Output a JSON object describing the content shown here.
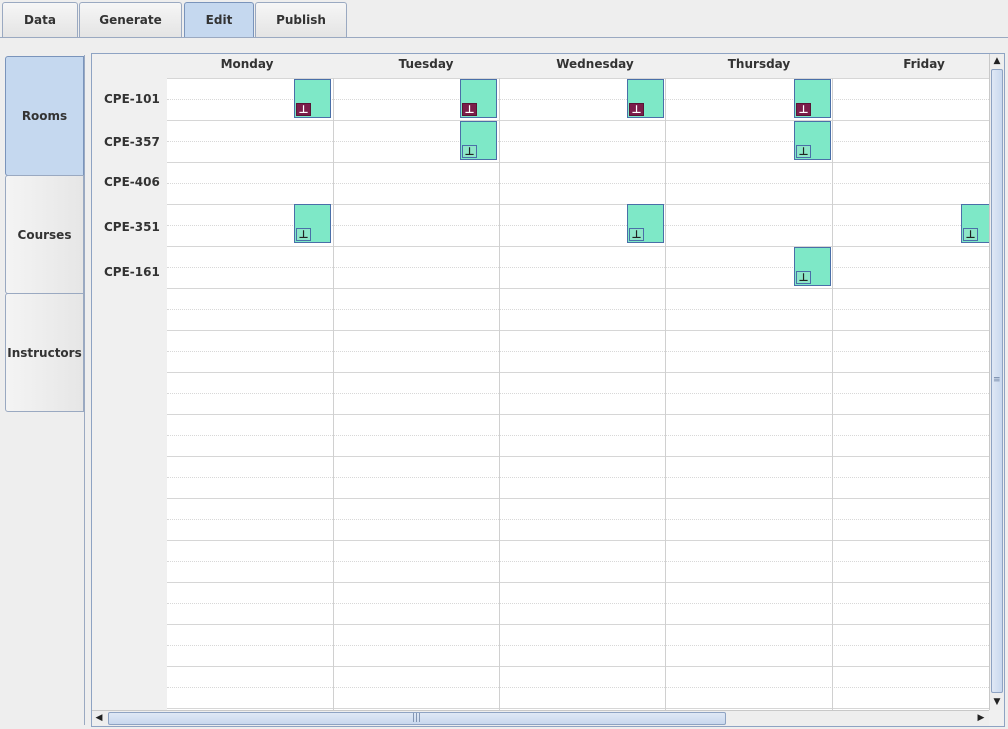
{
  "tabs": [
    {
      "label": "Data",
      "active": false
    },
    {
      "label": "Generate",
      "active": false
    },
    {
      "label": "Edit",
      "active": true
    },
    {
      "label": "Publish",
      "active": false
    }
  ],
  "side_tabs": [
    {
      "label": "Rooms",
      "active": true
    },
    {
      "label": "Courses",
      "active": false
    },
    {
      "label": "Instructors",
      "active": false
    }
  ],
  "schedule": {
    "days": [
      "Monday",
      "Tuesday",
      "Wednesday",
      "Thursday",
      "Friday"
    ],
    "rooms": [
      "CPE-101",
      "CPE-357",
      "CPE-406",
      "CPE-351",
      "CPE-161"
    ],
    "pin_icon": "pushpin-icon",
    "block_color": "#7ee8c7",
    "locked_pin_color": "#7b1e4a",
    "blocks": [
      {
        "room": "CPE-101",
        "day": "Monday",
        "locked": true
      },
      {
        "room": "CPE-101",
        "day": "Tuesday",
        "locked": true
      },
      {
        "room": "CPE-101",
        "day": "Wednesday",
        "locked": true
      },
      {
        "room": "CPE-101",
        "day": "Thursday",
        "locked": true
      },
      {
        "room": "CPE-357",
        "day": "Tuesday",
        "locked": false
      },
      {
        "room": "CPE-357",
        "day": "Thursday",
        "locked": false
      },
      {
        "room": "CPE-351",
        "day": "Monday",
        "locked": false
      },
      {
        "room": "CPE-351",
        "day": "Wednesday",
        "locked": false
      },
      {
        "room": "CPE-351",
        "day": "Friday",
        "locked": false
      },
      {
        "room": "CPE-161",
        "day": "Thursday",
        "locked": false
      }
    ]
  }
}
